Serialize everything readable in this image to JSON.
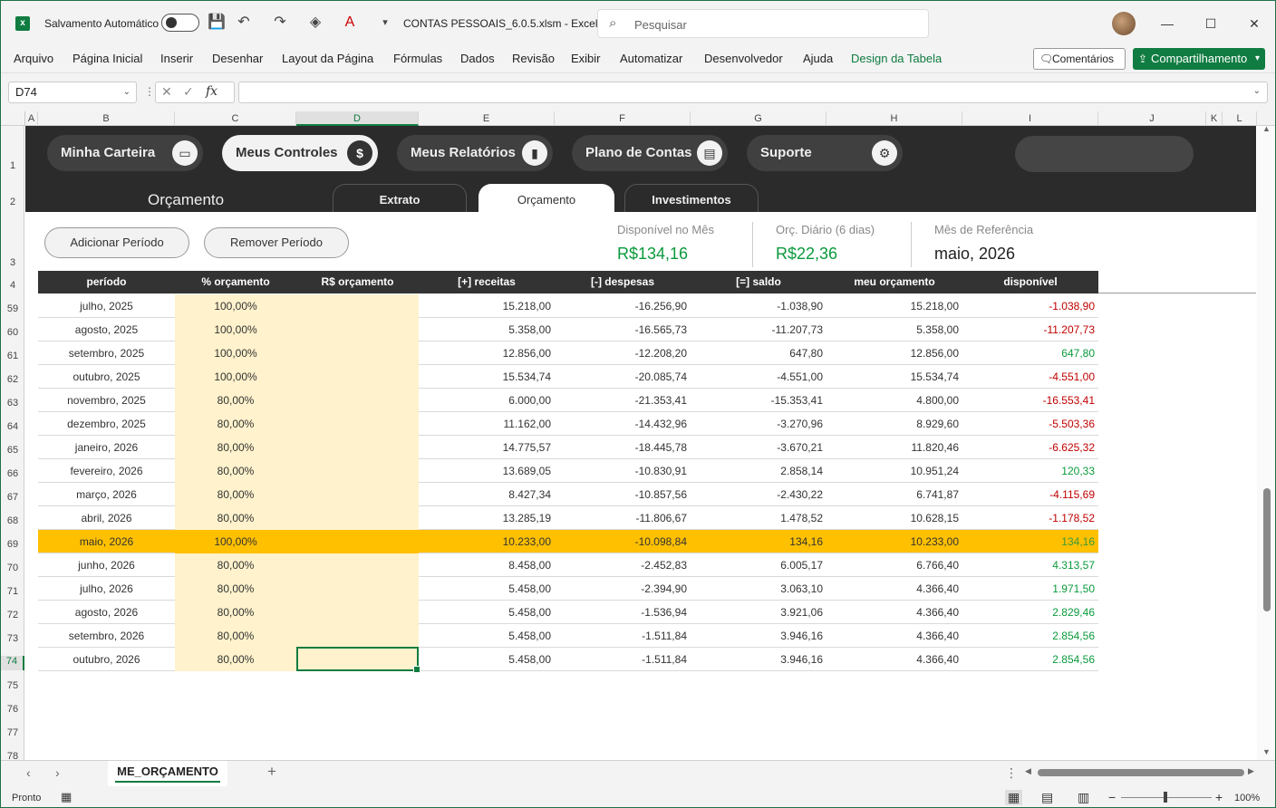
{
  "titlebar": {
    "autosave_label": "Salvamento Automático",
    "filename": "CONTAS PESSOAIS_6.0.5.xlsm  -  Excel",
    "search_placeholder": "Pesquisar"
  },
  "ribbon": {
    "tabs": [
      "Arquivo",
      "Página Inicial",
      "Inserir",
      "Desenhar",
      "Layout da Página",
      "Fórmulas",
      "Dados",
      "Revisão",
      "Exibir",
      "Automatizar",
      "Desenvolvedor",
      "Ajuda",
      "Design da Tabela"
    ],
    "comments_label": "Comentários",
    "share_label": "Compartilhamento"
  },
  "formula_bar": {
    "name_box": "D74",
    "formula": ""
  },
  "columns": [
    "A",
    "B",
    "C",
    "D",
    "E",
    "F",
    "G",
    "H",
    "I",
    "J",
    "K",
    "L"
  ],
  "selected_column": "D",
  "rows": [
    "1",
    "2",
    "3",
    "4",
    "59",
    "60",
    "61",
    "62",
    "63",
    "64",
    "65",
    "66",
    "67",
    "68",
    "69",
    "70",
    "71",
    "72",
    "73",
    "74",
    "75",
    "76",
    "77",
    "78"
  ],
  "selected_row": "74",
  "nav": {
    "pills": [
      {
        "label": "Minha Carteira",
        "icon": "wallet-icon",
        "glyph": "▭"
      },
      {
        "label": "Meus Controles",
        "icon": "dollar-icon",
        "glyph": "$"
      },
      {
        "label": "Meus Relatórios",
        "icon": "chart-icon",
        "glyph": "▮"
      },
      {
        "label": "Plano de Contas",
        "icon": "document-icon",
        "glyph": "▤"
      },
      {
        "label": "Suporte",
        "icon": "gear-icon",
        "glyph": "⚙"
      }
    ],
    "active": "Meus Controles",
    "section_title": "Orçamento",
    "subtabs": [
      "Extrato",
      "Orçamento",
      "Investimentos"
    ],
    "active_subtab": "Orçamento"
  },
  "controls": {
    "add_period": "Adicionar Período",
    "remove_period": "Remover Período"
  },
  "kpis": {
    "available_label": "Disponível no Mês",
    "available_value": "R$134,16",
    "daily_label": "Orç. Diário (6 dias)",
    "daily_value": "R$22,36",
    "ref_label": "Mês de Referência",
    "ref_value": "maio, 2026"
  },
  "table": {
    "headers": [
      "período",
      "% orçamento",
      "R$ orçamento",
      "[+] receitas",
      "[-] despesas",
      "[=] saldo",
      "meu orçamento",
      "disponível"
    ],
    "rows": [
      [
        "julho, 2025",
        "100,00%",
        "",
        "15.218,00",
        "-16.256,90",
        "-1.038,90",
        "15.218,00",
        "-1.038,90"
      ],
      [
        "agosto, 2025",
        "100,00%",
        "",
        "5.358,00",
        "-16.565,73",
        "-11.207,73",
        "5.358,00",
        "-11.207,73"
      ],
      [
        "setembro, 2025",
        "100,00%",
        "",
        "12.856,00",
        "-12.208,20",
        "647,80",
        "12.856,00",
        "647,80"
      ],
      [
        "outubro, 2025",
        "100,00%",
        "",
        "15.534,74",
        "-20.085,74",
        "-4.551,00",
        "15.534,74",
        "-4.551,00"
      ],
      [
        "novembro, 2025",
        "80,00%",
        "",
        "6.000,00",
        "-21.353,41",
        "-15.353,41",
        "4.800,00",
        "-16.553,41"
      ],
      [
        "dezembro, 2025",
        "80,00%",
        "",
        "11.162,00",
        "-14.432,96",
        "-3.270,96",
        "8.929,60",
        "-5.503,36"
      ],
      [
        "janeiro, 2026",
        "80,00%",
        "",
        "14.775,57",
        "-18.445,78",
        "-3.670,21",
        "11.820,46",
        "-6.625,32"
      ],
      [
        "fevereiro, 2026",
        "80,00%",
        "",
        "13.689,05",
        "-10.830,91",
        "2.858,14",
        "10.951,24",
        "120,33"
      ],
      [
        "março, 2026",
        "80,00%",
        "",
        "8.427,34",
        "-10.857,56",
        "-2.430,22",
        "6.741,87",
        "-4.115,69"
      ],
      [
        "abril, 2026",
        "80,00%",
        "",
        "13.285,19",
        "-11.806,67",
        "1.478,52",
        "10.628,15",
        "-1.178,52"
      ],
      [
        "maio, 2026",
        "100,00%",
        "",
        "10.233,00",
        "-10.098,84",
        "134,16",
        "10.233,00",
        "134,16"
      ],
      [
        "junho, 2026",
        "80,00%",
        "",
        "8.458,00",
        "-2.452,83",
        "6.005,17",
        "6.766,40",
        "4.313,57"
      ],
      [
        "julho, 2026",
        "80,00%",
        "",
        "5.458,00",
        "-2.394,90",
        "3.063,10",
        "4.366,40",
        "1.971,50"
      ],
      [
        "agosto, 2026",
        "80,00%",
        "",
        "5.458,00",
        "-1.536,94",
        "3.921,06",
        "4.366,40",
        "2.829,46"
      ],
      [
        "setembro, 2026",
        "80,00%",
        "",
        "5.458,00",
        "-1.511,84",
        "3.946,16",
        "4.366,40",
        "2.854,56"
      ],
      [
        "outubro, 2026",
        "80,00%",
        "",
        "5.458,00",
        "-1.511,84",
        "3.946,16",
        "4.366,40",
        "2.854,56"
      ]
    ],
    "highlighted_row": "maio, 2026"
  },
  "sheet_tab": "ME_ORÇAMENTO",
  "status": {
    "mode": "Pronto",
    "zoom": "100%"
  },
  "colors": {
    "accent": "#107c41",
    "highlight": "#ffc000",
    "budget_fill": "#fff2cc",
    "negative": "#c00000",
    "positive": "#0a9a3c"
  }
}
